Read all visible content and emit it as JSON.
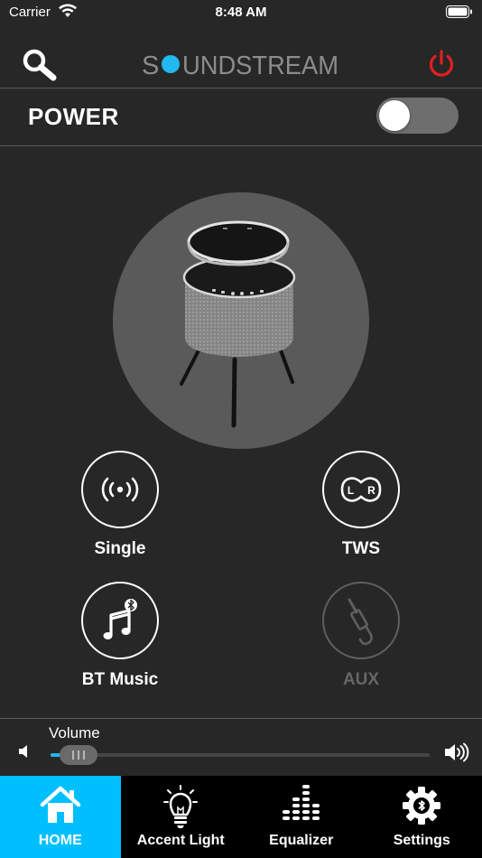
{
  "status": {
    "carrier": "Carrier",
    "time": "8:48 AM"
  },
  "header": {
    "logo_prefix": "S",
    "logo_suffix": "UNDSTREAM",
    "logo_accent_color": "#22b8f0"
  },
  "power": {
    "label": "POWER",
    "on": false
  },
  "modes": {
    "single": {
      "label": "Single",
      "enabled": true
    },
    "tws": {
      "label": "TWS",
      "enabled": true,
      "icon_left": "L",
      "icon_right": "R"
    },
    "bt_music": {
      "label": "BT Music",
      "enabled": true
    },
    "aux": {
      "label": "AUX",
      "enabled": false
    }
  },
  "volume": {
    "label": "Volume",
    "level": 0.04
  },
  "tabs": [
    {
      "label": "HOME",
      "icon": "home-icon",
      "active": true
    },
    {
      "label": "Accent Light",
      "icon": "light-bulb-icon",
      "active": false
    },
    {
      "label": "Equalizer",
      "icon": "equalizer-icon",
      "active": false
    },
    {
      "label": "Settings",
      "icon": "settings-gear-icon",
      "active": false
    }
  ],
  "colors": {
    "background": "#272727",
    "accent": "#00bfff",
    "power_icon": "#e02020"
  }
}
